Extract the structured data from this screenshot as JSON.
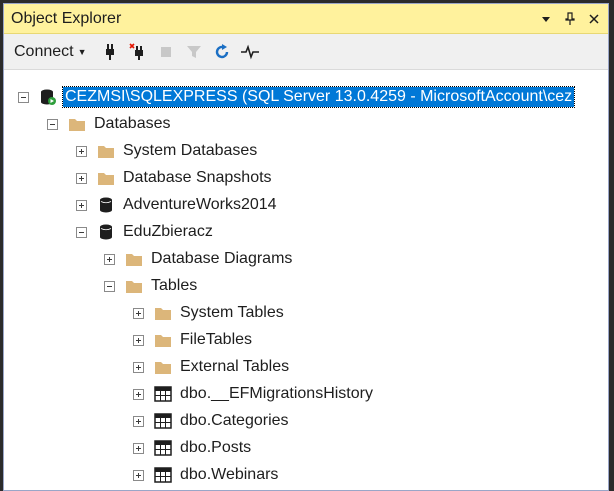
{
  "panel": {
    "title": "Object Explorer",
    "title_buttons": [
      "dropdown-arrow",
      "pin",
      "close"
    ]
  },
  "toolbar": {
    "connect_label": "Connect",
    "tools": [
      "connect-plug-icon",
      "disconnect-plug-icon",
      "stop-icon",
      "filter-icon",
      "refresh-icon",
      "activity-monitor-icon"
    ]
  },
  "tree": {
    "server": "CEZMSI\\SQLEXPRESS (SQL Server 13.0.4259 - MicrosoftAccount\\cez",
    "databases": "Databases",
    "system_databases": "System Databases",
    "database_snapshots": "Database Snapshots",
    "adventureworks": "AdventureWorks2014",
    "eduzbieracz": "EduZbieracz",
    "database_diagrams": "Database Diagrams",
    "tables": "Tables",
    "system_tables": "System Tables",
    "filetables": "FileTables",
    "external_tables": "External Tables",
    "t1": "dbo.__EFMigrationsHistory",
    "t2": "dbo.Categories",
    "t3": "dbo.Posts",
    "t4": "dbo.Webinars"
  },
  "colors": {
    "title_bg": "#fff29d",
    "selection": "#0078d7",
    "folder": "#dcb67a"
  }
}
